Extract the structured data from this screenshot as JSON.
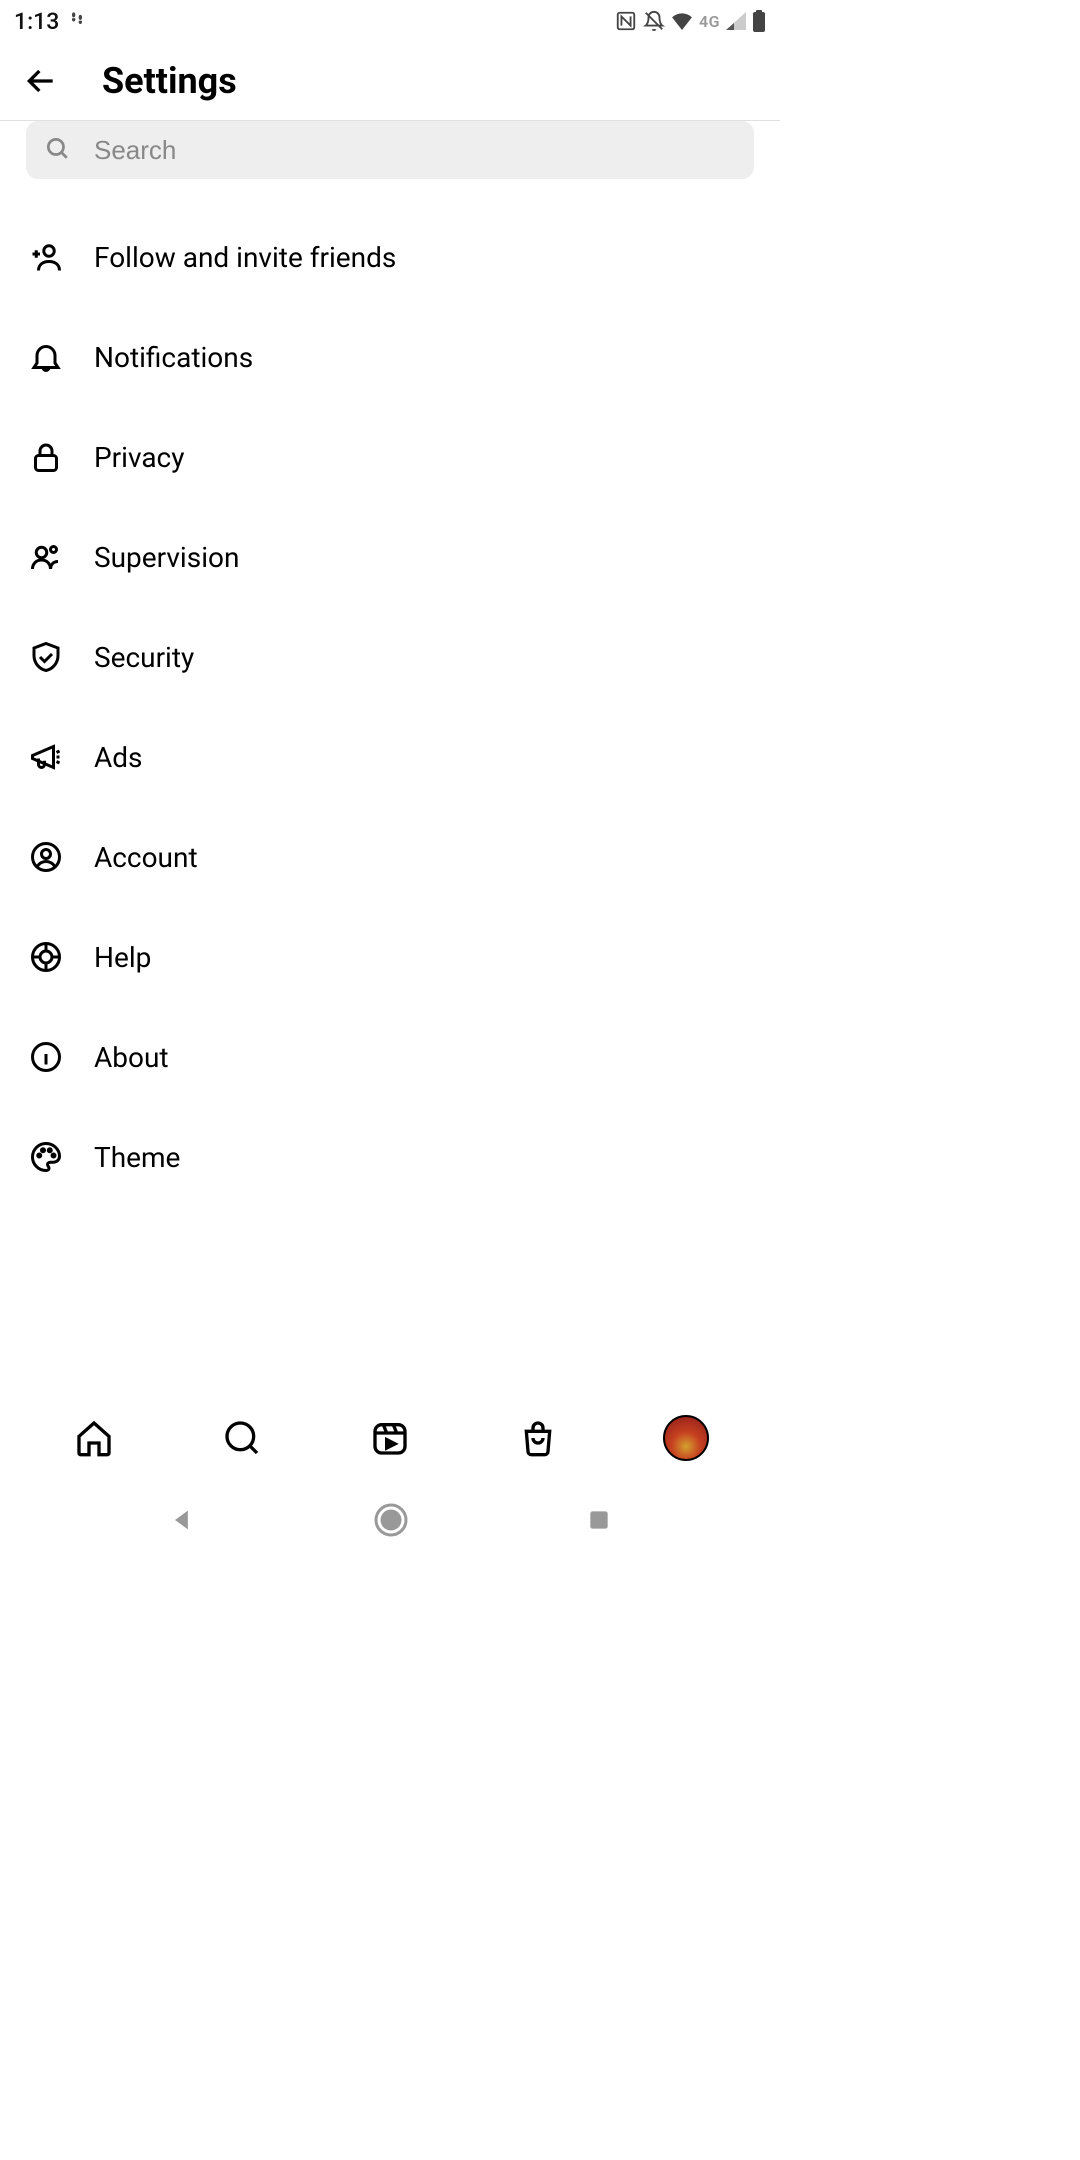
{
  "status_bar": {
    "time": "1:13",
    "network_label": "4G"
  },
  "header": {
    "title": "Settings"
  },
  "search": {
    "placeholder": "Search"
  },
  "settings": {
    "items": [
      {
        "label": "Follow and invite friends",
        "icon": "add-person-icon"
      },
      {
        "label": "Notifications",
        "icon": "bell-icon"
      },
      {
        "label": "Privacy",
        "icon": "lock-icon"
      },
      {
        "label": "Supervision",
        "icon": "people-icon"
      },
      {
        "label": "Security",
        "icon": "shield-icon"
      },
      {
        "label": "Ads",
        "icon": "megaphone-icon"
      },
      {
        "label": "Account",
        "icon": "user-circle-icon"
      },
      {
        "label": "Help",
        "icon": "lifebuoy-icon"
      },
      {
        "label": "About",
        "icon": "info-icon"
      },
      {
        "label": "Theme",
        "icon": "palette-icon"
      }
    ]
  },
  "bottom_nav": {
    "items": [
      "home",
      "search",
      "reels",
      "shop",
      "profile"
    ]
  }
}
